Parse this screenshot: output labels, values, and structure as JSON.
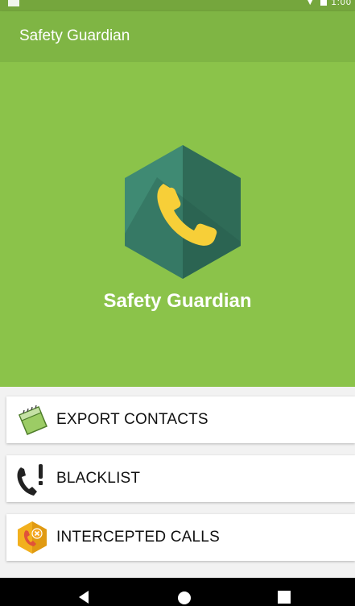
{
  "status_bar": {
    "time": "1:00"
  },
  "app_bar": {
    "title": "Safety Guardian"
  },
  "hero": {
    "title": "Safety Guardian"
  },
  "menu": [
    {
      "label": "EXPORT CONTACTS",
      "icon": "calendar-icon"
    },
    {
      "label": "BLACKLIST",
      "icon": "phone-alert-icon"
    },
    {
      "label": "INTERCEPTED CALLS",
      "icon": "blocked-call-icon"
    }
  ],
  "nav": {
    "back": "back-icon",
    "home": "home-icon",
    "recents": "recents-icon"
  },
  "colors": {
    "app_bar": "#7fb544",
    "hero": "#8bc34a",
    "hex_dark": "#2f6b57",
    "hex_light": "#3f8a73",
    "phone_yellow": "#f7cf38"
  }
}
